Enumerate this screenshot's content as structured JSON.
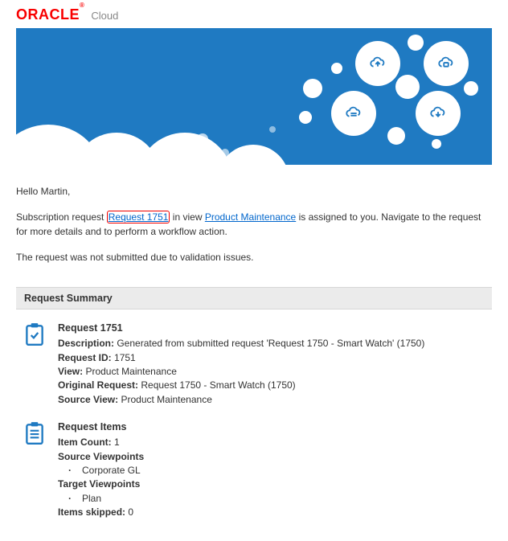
{
  "brand": {
    "logo_text": "ORACLE",
    "logo_reg": "®",
    "product": "Cloud"
  },
  "greeting": "Hello Martin,",
  "intro": {
    "prefix": "Subscription request ",
    "request_link": "Request 1751",
    "mid1": " in view ",
    "view_link": "Product Maintenance",
    "suffix": " is assigned to you. Navigate to the request for more details and to perform a workflow action."
  },
  "validation_msg": "The request was not submitted due to validation issues.",
  "summary_header": "Request Summary",
  "request": {
    "title": "Request 1751",
    "desc_label": "Description:",
    "desc_value": " Generated from submitted request 'Request 1750 - Smart Watch' (1750)",
    "id_label": "Request ID:",
    "id_value": " 1751",
    "view_label": "View:",
    "view_value": " Product Maintenance",
    "orig_label": "Original Request:",
    "orig_value": " Request 1750 - Smart Watch (1750)",
    "srcview_label": "Source View:",
    "srcview_value": " Product Maintenance"
  },
  "items": {
    "title": "Request Items",
    "count_label": "Item Count:",
    "count_value": " 1",
    "source_vp_label": "Source Viewpoints",
    "source_vp_item": "Corporate GL",
    "target_vp_label": "Target Viewpoints",
    "target_vp_item": "Plan",
    "skipped_label": "Items skipped:",
    "skipped_value": " 0"
  }
}
